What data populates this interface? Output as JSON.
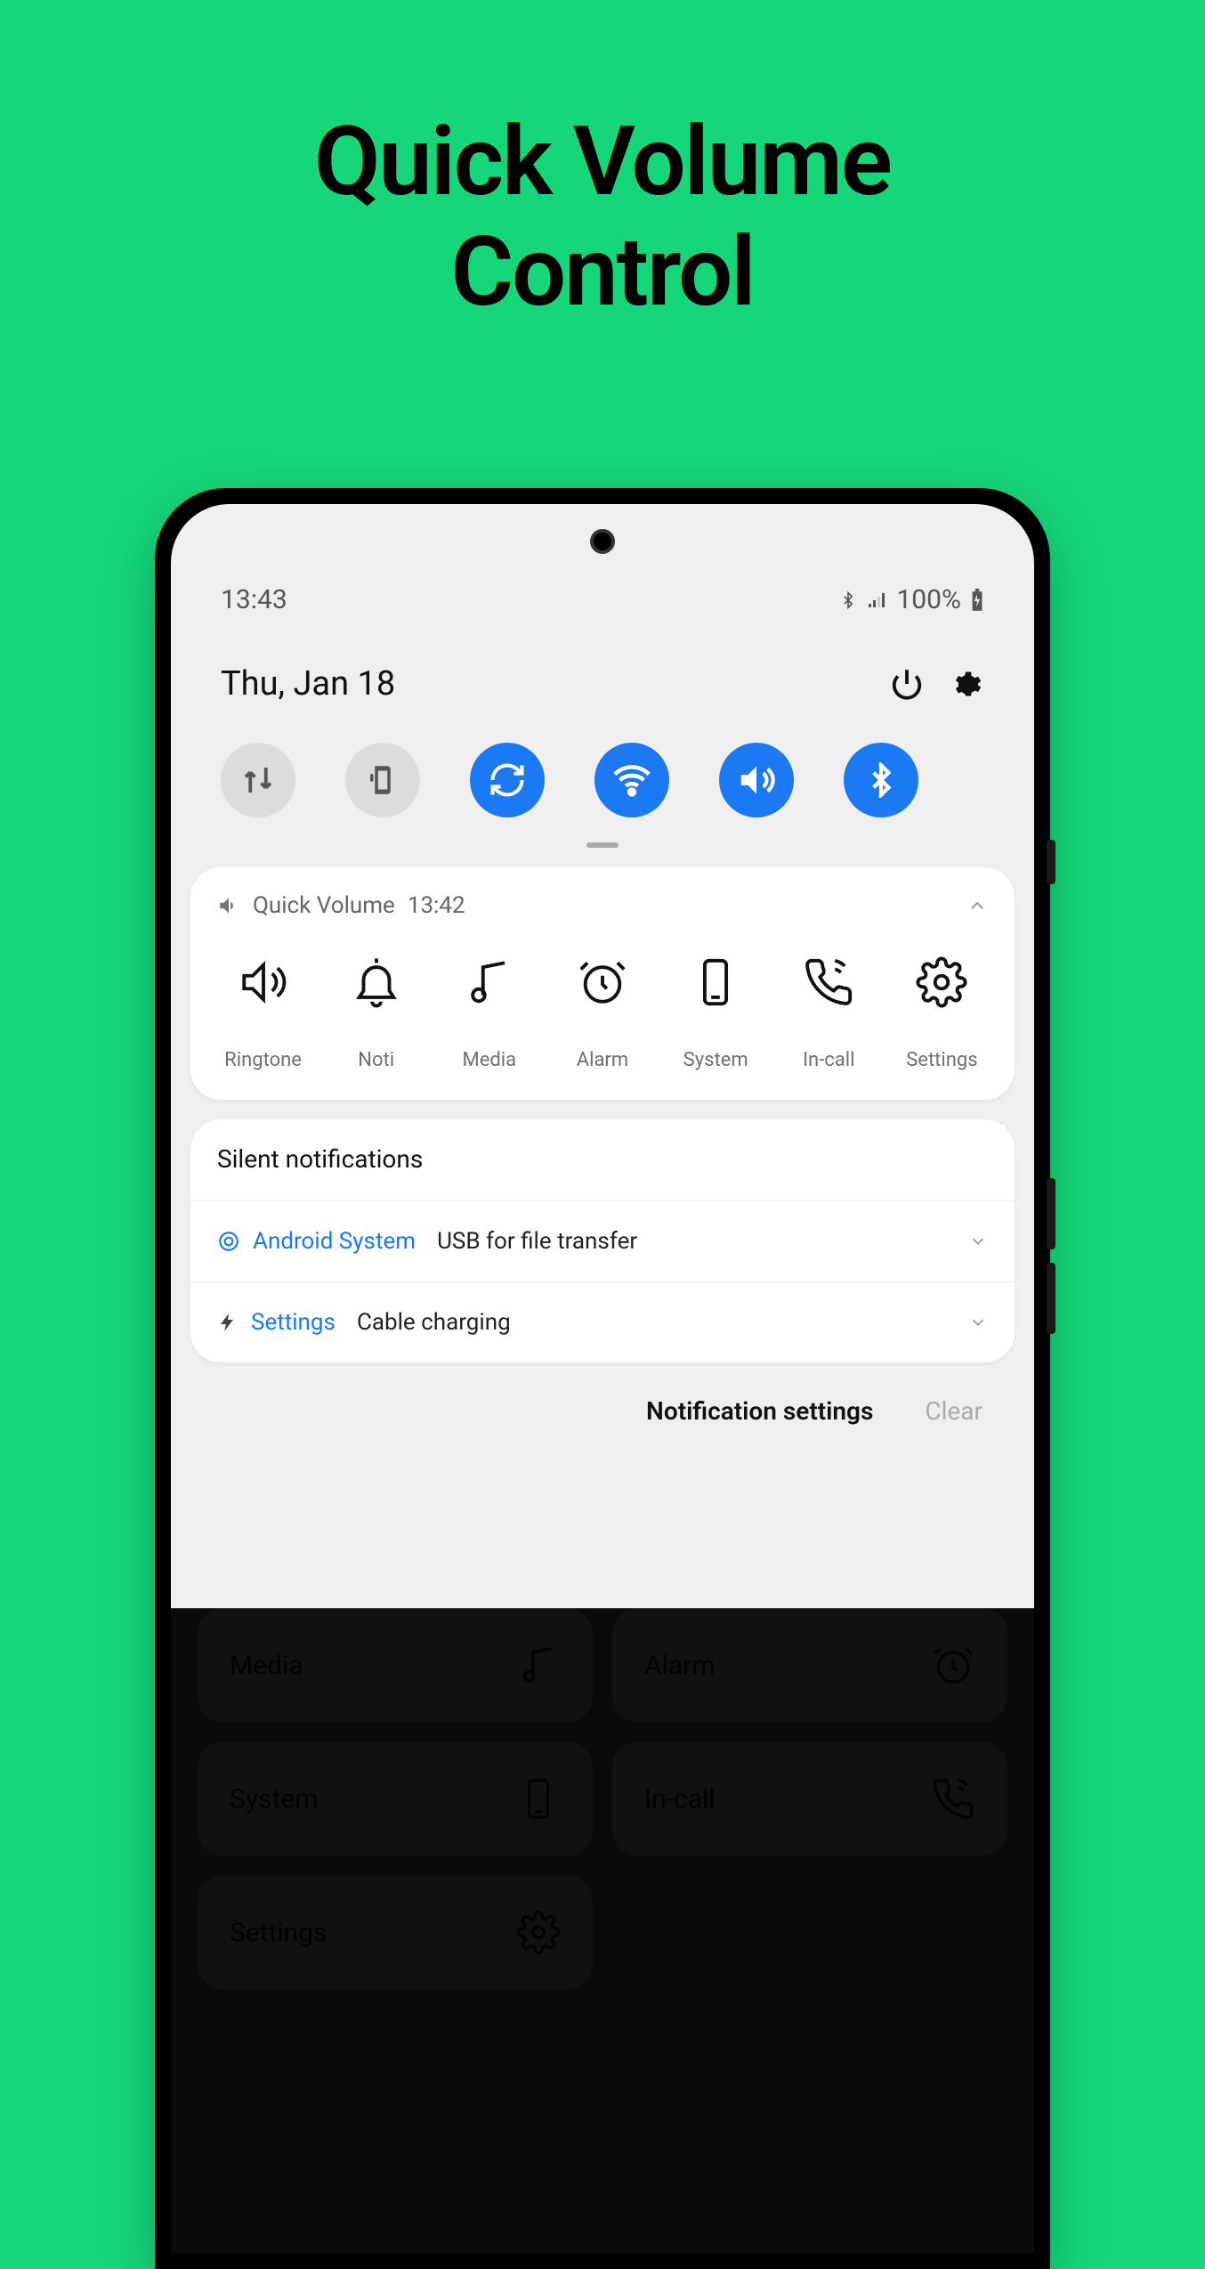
{
  "promo": {
    "title_line1": "Quick Volume",
    "title_line2": "Control"
  },
  "statusbar": {
    "time": "13:43",
    "battery": "100%"
  },
  "header": {
    "date": "Thu, Jan 18"
  },
  "toggles": {
    "items": [
      {
        "name": "data-transfer-icon",
        "on": false
      },
      {
        "name": "side-key-icon",
        "on": false
      },
      {
        "name": "sync-icon",
        "on": true
      },
      {
        "name": "wifi-icon",
        "on": true
      },
      {
        "name": "sound-icon",
        "on": true
      },
      {
        "name": "bluetooth-icon",
        "on": true
      }
    ]
  },
  "qv": {
    "app": "Quick Volume",
    "time": "13:42",
    "items": [
      {
        "label": "Ringtone"
      },
      {
        "label": "Noti"
      },
      {
        "label": "Media"
      },
      {
        "label": "Alarm"
      },
      {
        "label": "System"
      },
      {
        "label": "In-call"
      },
      {
        "label": "Settings"
      }
    ]
  },
  "silent": {
    "title": "Silent notifications",
    "rows": [
      {
        "app": "Android System",
        "sub": "USB for file transfer"
      },
      {
        "app": "Settings",
        "sub": "Cable charging"
      }
    ]
  },
  "footer": {
    "settings": "Notification settings",
    "clear": "Clear"
  },
  "bgapp": {
    "tiles": [
      {
        "label": "Media"
      },
      {
        "label": "Alarm"
      },
      {
        "label": "System"
      },
      {
        "label": "In-call"
      },
      {
        "label": "Settings"
      }
    ]
  }
}
